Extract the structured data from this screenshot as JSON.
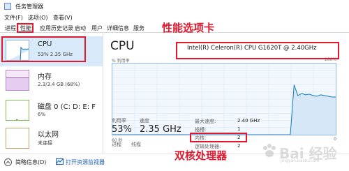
{
  "window": {
    "title": "任务管理器"
  },
  "menu": {
    "items": [
      "文件(F)",
      "选项(O)",
      "查看(V)"
    ]
  },
  "tabs": [
    "进程",
    "性能",
    "应用历史记录",
    "启动",
    "用户",
    "详细信息",
    "服务"
  ],
  "active_tab": "性能",
  "sidebar": {
    "items": [
      {
        "title": "CPU",
        "subtitle": "53% 2.35 GHz",
        "icon": "cpu-thumbnail"
      },
      {
        "title": "内存",
        "subtitle": "2.3/3.4 GB (68%)",
        "icon": "memory-thumbnail"
      },
      {
        "title": "磁盘 0 (C: D: E: F",
        "subtitle": "6%",
        "icon": "disk-thumbnail"
      },
      {
        "title": "以太网",
        "subtitle": "未连接",
        "icon": "ethernet-thumbnail"
      }
    ]
  },
  "main": {
    "heading": "CPU",
    "model": "Intel(R) Celeron(R) CPU G1620T @ 2.40GHz",
    "graph": {
      "top_left": "% 利用率",
      "top_right": "100%",
      "bottom_left": "60 秒",
      "bottom_right": "0",
      "usage_series": [
        0,
        0,
        0,
        0,
        0,
        0,
        0,
        0,
        0,
        0,
        0,
        0,
        0,
        0,
        0,
        0,
        0,
        0,
        0,
        0,
        0,
        0,
        0,
        0,
        0,
        0,
        0,
        0,
        0,
        0,
        0,
        0,
        0,
        0,
        0,
        0,
        0,
        0,
        0,
        0,
        0,
        0,
        0,
        0,
        0,
        0,
        0,
        0,
        70,
        55,
        58,
        56,
        57,
        55,
        54,
        56,
        55,
        54,
        53,
        53
      ]
    }
  },
  "stats": {
    "utilization_label": "利用率",
    "utilization_value": "53%",
    "speed_label": "速度",
    "speed_value": "2.35 GHz",
    "processes_label": "进程",
    "threads_label": "线程",
    "max_speed_label": "最大速度:",
    "max_speed_value": "2.40 GHz",
    "sockets_label": "插槽:",
    "sockets_value": "1",
    "cores_label": "内核:",
    "cores_value": "2",
    "logical_label": "逻辑处理器:",
    "logical_value": "2"
  },
  "footer": {
    "summary": "简略信息(D)",
    "resmon": "打开资源监视器"
  },
  "annotations": {
    "performance_tab": "性能选项卡",
    "dual_core": "双核处理器"
  },
  "colors": {
    "annotation": "#e0192e",
    "graph_line": "#1177bb",
    "graph_fill": "#d6e8f7",
    "selection": "#d8eaf9"
  },
  "watermark": {
    "text": "Bai 经验",
    "url": "jingyan.baidu.com"
  }
}
